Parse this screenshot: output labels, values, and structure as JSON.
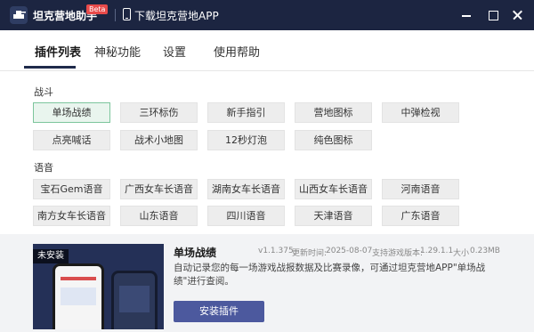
{
  "titlebar": {
    "app_name": "坦克营地助手",
    "beta": "Beta",
    "download": "下载坦克营地APP"
  },
  "tabs": [
    {
      "label": "插件列表",
      "active": true
    },
    {
      "label": "神秘功能",
      "active": false
    },
    {
      "label": "设置",
      "active": false
    },
    {
      "label": "使用帮助",
      "active": false
    }
  ],
  "sections": {
    "battle": {
      "title": "战斗",
      "items": [
        "单场战绩",
        "三环标伤",
        "新手指引",
        "营地图标",
        "中弹检视",
        "点亮喊话",
        "战术小地图",
        "12秒灯泡",
        "纯色图标"
      ]
    },
    "voice": {
      "title": "语音",
      "items": [
        "宝石Gem语音",
        "广西女车长语音",
        "湖南女车长语音",
        "山西女车长语音",
        "河南语音",
        "南方女车长语音",
        "山东语音",
        "四川语音",
        "天津语音",
        "广东语音"
      ]
    }
  },
  "detail": {
    "badge": "未安装",
    "name": "单场战绩",
    "version": "v1.1.375",
    "updated_label": "更新时间:",
    "updated": "2025-08-07",
    "support_label": "支持游戏版本:",
    "support": "1.29.1.1",
    "size_label": "大小",
    "size": "0.23MB",
    "description": "自动记录您的每一场游戏战报数据及比赛录像，可通过坦克营地APP\"单场战绩\"进行查阅。",
    "install": "安装插件"
  },
  "colors": {
    "titlebar": "#1c2541",
    "accent": "#4c599e",
    "selected_border": "#7cc59c",
    "beta": "#e84a4a"
  }
}
